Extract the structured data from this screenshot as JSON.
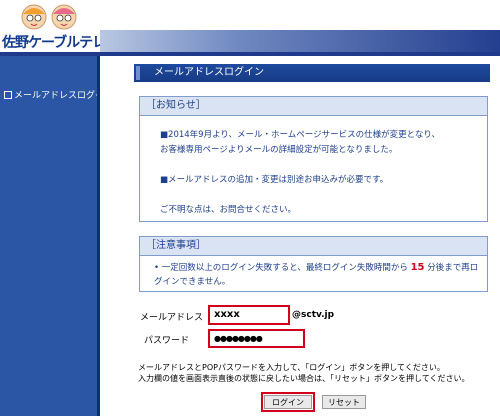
{
  "brand": {
    "logo_text": "佐野ケーブルテレビ"
  },
  "sidebar": {
    "items": [
      {
        "label": "メールアドレスログイン"
      }
    ]
  },
  "page": {
    "title": "メールアドレスログイン"
  },
  "notice": {
    "heading": "［お知らせ］",
    "line1": "■2014年9月より、メール・ホームページサービスの仕様が変更となり、",
    "line2": "お客様専用ページよりメールの詳細設定が可能となりました。",
    "line3": "■メールアドレスの追加・変更は別途お申込みが必要です。",
    "line4": "ご不明な点は、お問合せください。"
  },
  "caution": {
    "heading": "［注意事項］",
    "text_before": "一定回数以上のログイン失敗すると、最終ログイン失敗時間から",
    "minutes": "15",
    "text_after": "分後まで再ログインできません。"
  },
  "form": {
    "email_label": "メールアドレス",
    "email_value": "xxxx",
    "domain": "@sctv.jp",
    "password_label": "パスワード",
    "password_value": "●●●●●●●●"
  },
  "instructions": {
    "line1": "メールアドレスとPOPパスワードを入力して、「ログイン」ボタンを押してください。",
    "line2": "入力欄の値を画面表示直後の状態に戻したい場合は、「リセット」ボタンを押してください。"
  },
  "buttons": {
    "login": "ログイン",
    "reset": "リセット"
  },
  "colors": {
    "header_blue": "#1f3a8a",
    "sidebar_blue": "#2b56a6",
    "highlight_red": "#d1001c"
  }
}
